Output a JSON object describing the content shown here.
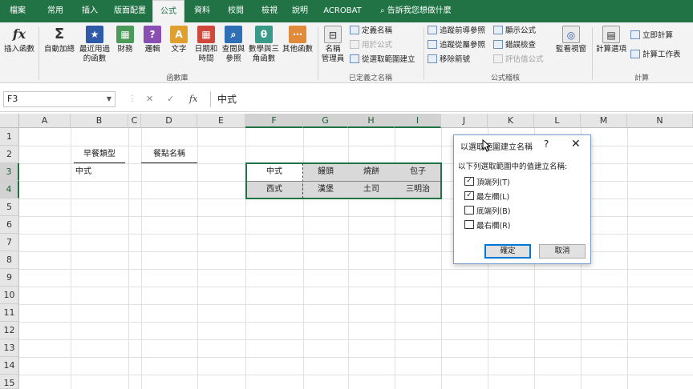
{
  "ribbon_tabs": [
    "檔案",
    "常用",
    "插入",
    "版面配置",
    "公式",
    "資料",
    "校閱",
    "檢視",
    "說明",
    "ACROBAT"
  ],
  "active_tab": "公式",
  "tell_me": "告訴我您想做什麼",
  "ribbon": {
    "insert_function": "插入函數",
    "autosum": [
      "自動加總"
    ],
    "recent": [
      "最近用過",
      "的函數"
    ],
    "financial": [
      "財務"
    ],
    "logical": [
      "邏輯"
    ],
    "text": [
      "文字"
    ],
    "datetime": [
      "日期和",
      "時間"
    ],
    "lookup": [
      "查閱與",
      "參照"
    ],
    "math": [
      "數學與三",
      "角函數"
    ],
    "more": [
      "其他函數"
    ],
    "group_library": "函數庫",
    "name_manager": [
      "名稱",
      "管理員"
    ],
    "define_name": "定義名稱",
    "use_in_formula": "用於公式",
    "create_from_selection": "從選取範圍建立",
    "group_names": "已定義之名稱",
    "trace_precedents": "追蹤前導參照",
    "trace_dependents": "追蹤從屬參照",
    "remove_arrows": "移除箭號",
    "show_formulas": "顯示公式",
    "error_checking": "錯誤檢查",
    "evaluate_formula": "評估值公式",
    "group_auditing": "公式稽核",
    "watch_window": "監看視窗",
    "calc_options": [
      "計算選項"
    ],
    "calc_now": "立即計算",
    "calc_sheet": "計算工作表",
    "group_calc": "計算"
  },
  "formula_bar": {
    "name_box": "F3",
    "cancel": "✕",
    "enter": "✓",
    "fx": "fx",
    "content": "中式"
  },
  "columns": [
    "A",
    "B",
    "C",
    "D",
    "E",
    "F",
    "G",
    "H",
    "I",
    "J",
    "K",
    "L",
    "M",
    "N"
  ],
  "rows": [
    "1",
    "2",
    "3",
    "4",
    "5",
    "6",
    "7",
    "8",
    "9",
    "10",
    "11",
    "12",
    "13",
    "14",
    "15"
  ],
  "cells": {
    "B2": "早餐類型",
    "D2": "餐點名稱",
    "B3": "中式",
    "F3": "中式",
    "G3": "饅頭",
    "H3": "燒餅",
    "I3": "包子",
    "F4": "西式",
    "G4": "漢堡",
    "H4": "土司",
    "I4": "三明治"
  },
  "dialog": {
    "title": "以選取範圍建立名稱",
    "help": "?",
    "close": "✕",
    "prompt": "以下列選取範圍中的值建立名稱:",
    "options": [
      {
        "label": "頂端列(T)",
        "checked": true
      },
      {
        "label": "最左欄(L)",
        "checked": true
      },
      {
        "label": "底端列(B)",
        "checked": false
      },
      {
        "label": "最右欄(R)",
        "checked": false
      }
    ],
    "ok": "確定",
    "cancel": "取消"
  }
}
